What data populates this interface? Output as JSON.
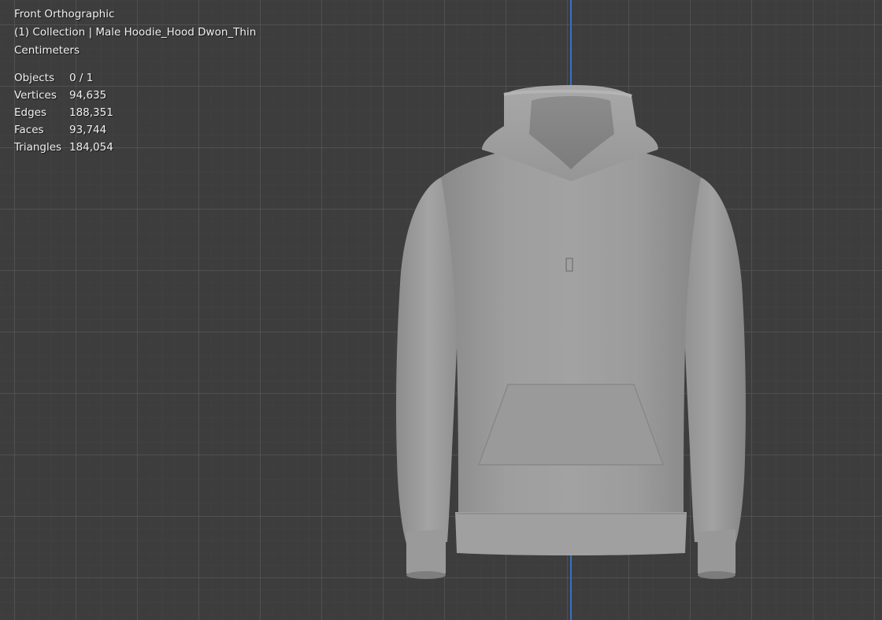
{
  "viewport": {
    "view_name": "Front Orthographic",
    "collection_info": "(1) Collection | Male Hoodie_Hood Dwon_Thin",
    "units": "Centimeters",
    "axis_color": "#3a6fc9",
    "background_color": "#3d3d3d"
  },
  "stats": [
    {
      "label": "Objects",
      "value": "0 / 1"
    },
    {
      "label": "Vertices",
      "value": "94,635"
    },
    {
      "label": "Edges",
      "value": "188,351"
    },
    {
      "label": "Faces",
      "value": "93,744"
    },
    {
      "label": "Triangles",
      "value": "184,054"
    }
  ],
  "model": {
    "icon": "hoodie-mesh",
    "color": "#9a9a9a"
  }
}
